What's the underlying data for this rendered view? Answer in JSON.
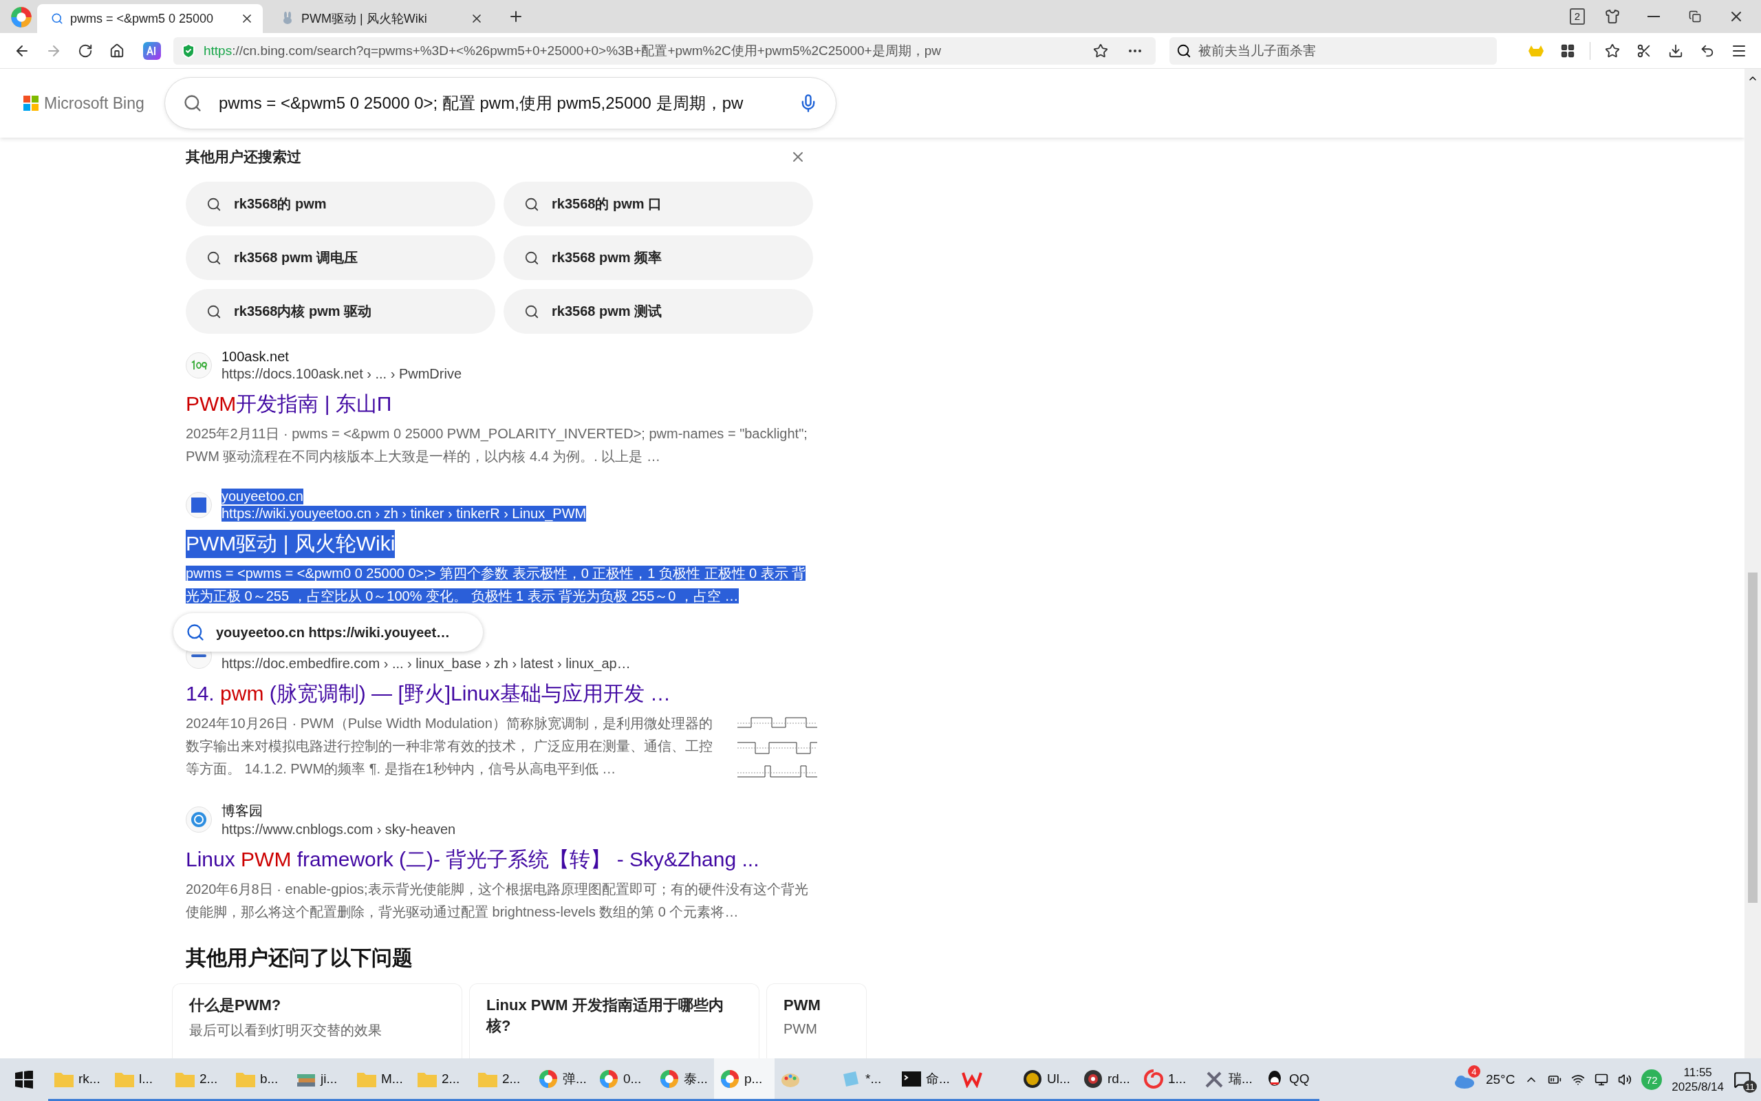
{
  "browser": {
    "tabs": [
      {
        "title": "pwms = <&pwm5 0 25000",
        "kind": "search",
        "selected": true
      },
      {
        "title": "PWM驱动 | 风火轮Wiki",
        "kind": "site",
        "selected": false
      }
    ],
    "tab_count": "2",
    "address": {
      "scheme": "https",
      "rest": "://cn.bing.com/search?q=pwms+%3D+<%26pwm5+0+25000+0>%3B+配置+pwm%2C使用+pwm5%2C25000+是周期，pw"
    },
    "search": {
      "placeholder": "被前夫当儿子面杀害"
    }
  },
  "bing": {
    "logo": "Microsoft Bing",
    "query": "pwms = <&pwm5 0 25000 0>; 配置 pwm,使用 pwm5,25000 是周期，pw"
  },
  "related": {
    "title": "其他用户还搜索过",
    "chips": [
      "rk3568的 pwm",
      "rk3568的 pwm 口",
      "rk3568 pwm 调电压",
      "rk3568 pwm 频率",
      "rk3568内核 pwm 驱动",
      "rk3568 pwm 测试"
    ]
  },
  "results": [
    {
      "kind": "ask",
      "site": "100ask.net",
      "url": "https://docs.100ask.net › ... › PwmDrive",
      "title": [
        {
          "text": "PWM",
          "match": true
        },
        {
          "text": "开发指南 | 东山Π",
          "match": false
        }
      ],
      "date": "2025年2月11日",
      "separator": "·",
      "snippet": "pwms = <&pwm 0 25000 PWM_POLARITY_INVERTED>; pwm-names = \"backlight\"; PWM 驱动流程在不同内核版本上大致是一样的，以内核 4.4 为例。. 以上是 …",
      "thumbnail": false,
      "selected": false
    },
    {
      "kind": "square",
      "site": "youyeetoo.cn",
      "url": "https://wiki.youyeetoo.cn › zh › tinker › tinkerR › Linux_PWM",
      "title": [
        {
          "text": "PWM驱动 | 风火轮Wiki",
          "match": false
        }
      ],
      "snippet": "pwms = <pwms = <&pwm0 0 25000 0>;> 第四个参数 表示极性，0 正极性，1 负极性 正极性 0 表示 背光为正极 0～255 ，占空比从 0～100% 变化。 负极性 1 表示 背光为负极 255～0 ，占空 …",
      "thumbnail": false,
      "selected": true
    },
    {
      "kind": "fire",
      "url": "https://doc.embedfire.com › ... › linux_base › zh › latest › linux_ap…",
      "title": [
        {
          "text": "14. ",
          "match": false
        },
        {
          "text": "pwm",
          "match": true
        },
        {
          "text": " (脉宽调制) — [野火]Linux基础与应用开发 …",
          "match": false
        }
      ],
      "date": "2024年10月26日",
      "separator": "·",
      "snippet": "PWM（Pulse Width Modulation）简称脉宽调制，是利用微处理器的数字输出来对模拟电路进行控制的一种非常有效的技术， 广泛应用在测量、通信、工控等方面。 14.1.2. PWM的频率 ¶. 是指在1秒钟内，信号从高电平到低 …",
      "thumbnail": true,
      "selected": false
    },
    {
      "kind": "blog",
      "site": "博客园",
      "url": "https://www.cnblogs.com › sky-heaven",
      "title": [
        {
          "text": "Linux ",
          "match": false
        },
        {
          "text": "PWM",
          "match": true
        },
        {
          "text": " framework (二)- 背光子系统【转】 - Sky&Zhang ...",
          "match": false
        }
      ],
      "date": "2020年6月8日",
      "separator": "·",
      "snippet": "enable-gpios;表示背光使能脚，这个根据电路原理图配置即可；有的硬件没有这个背光使能脚，那么将这个配置删除，背光驱动通过配置 brightness-levels 数组的第 0 个元素将…",
      "thumbnail": false,
      "selected": false
    }
  ],
  "popup": {
    "text": "youyeetoo.cn https://wiki.youyeet…"
  },
  "questions": {
    "title": "其他用户还问了以下问题",
    "cards": [
      {
        "question": "什么是PWM?",
        "answer": "最后可以看到灯明灭交替的效果"
      },
      {
        "question": "Linux PWM 开发指南适用于哪些内核?"
      },
      {
        "question": "PWM",
        "answer": "PWM"
      }
    ]
  },
  "taskbar": {
    "items": [
      {
        "kind": "folder",
        "label": "rk...",
        "selected": false
      },
      {
        "kind": "folder",
        "label": "l...",
        "selected": false
      },
      {
        "kind": "folder",
        "label": "2...",
        "selected": false
      },
      {
        "kind": "folder",
        "label": "b...",
        "selected": false
      },
      {
        "kind": "book",
        "label": "ji...",
        "selected": false
      },
      {
        "kind": "folder",
        "label": "M...",
        "selected": false
      },
      {
        "kind": "folder",
        "label": "2...",
        "selected": false
      },
      {
        "kind": "folder",
        "label": "2...",
        "selected": false
      },
      {
        "kind": "browser",
        "label": "弹...",
        "selected": false
      },
      {
        "kind": "browser",
        "label": "0...",
        "selected": false
      },
      {
        "kind": "browser",
        "label": "泰...",
        "selected": false
      },
      {
        "kind": "browser",
        "label": "p...",
        "selected": true
      },
      {
        "kind": "paint",
        "selected": false
      },
      {
        "kind": "notepad",
        "label": "*...",
        "selected": false
      },
      {
        "kind": "terminal",
        "label": "命...",
        "selected": false
      },
      {
        "kind": "wps",
        "selected": false
      },
      {
        "kind": "ue",
        "label": "Ul...",
        "selected": false
      },
      {
        "kind": "disc",
        "label": "rd...",
        "selected": false
      },
      {
        "kind": "swirl",
        "label": "1...",
        "selected": false
      },
      {
        "kind": "tools",
        "label": "瑞...",
        "selected": false
      },
      {
        "kind": "qq",
        "label": "QQ",
        "selected": false
      }
    ],
    "weather_badge": "4",
    "temperature": "25°C",
    "security_score": "72",
    "time": "11:55",
    "date": "2025/8/14",
    "notifications": "11"
  }
}
